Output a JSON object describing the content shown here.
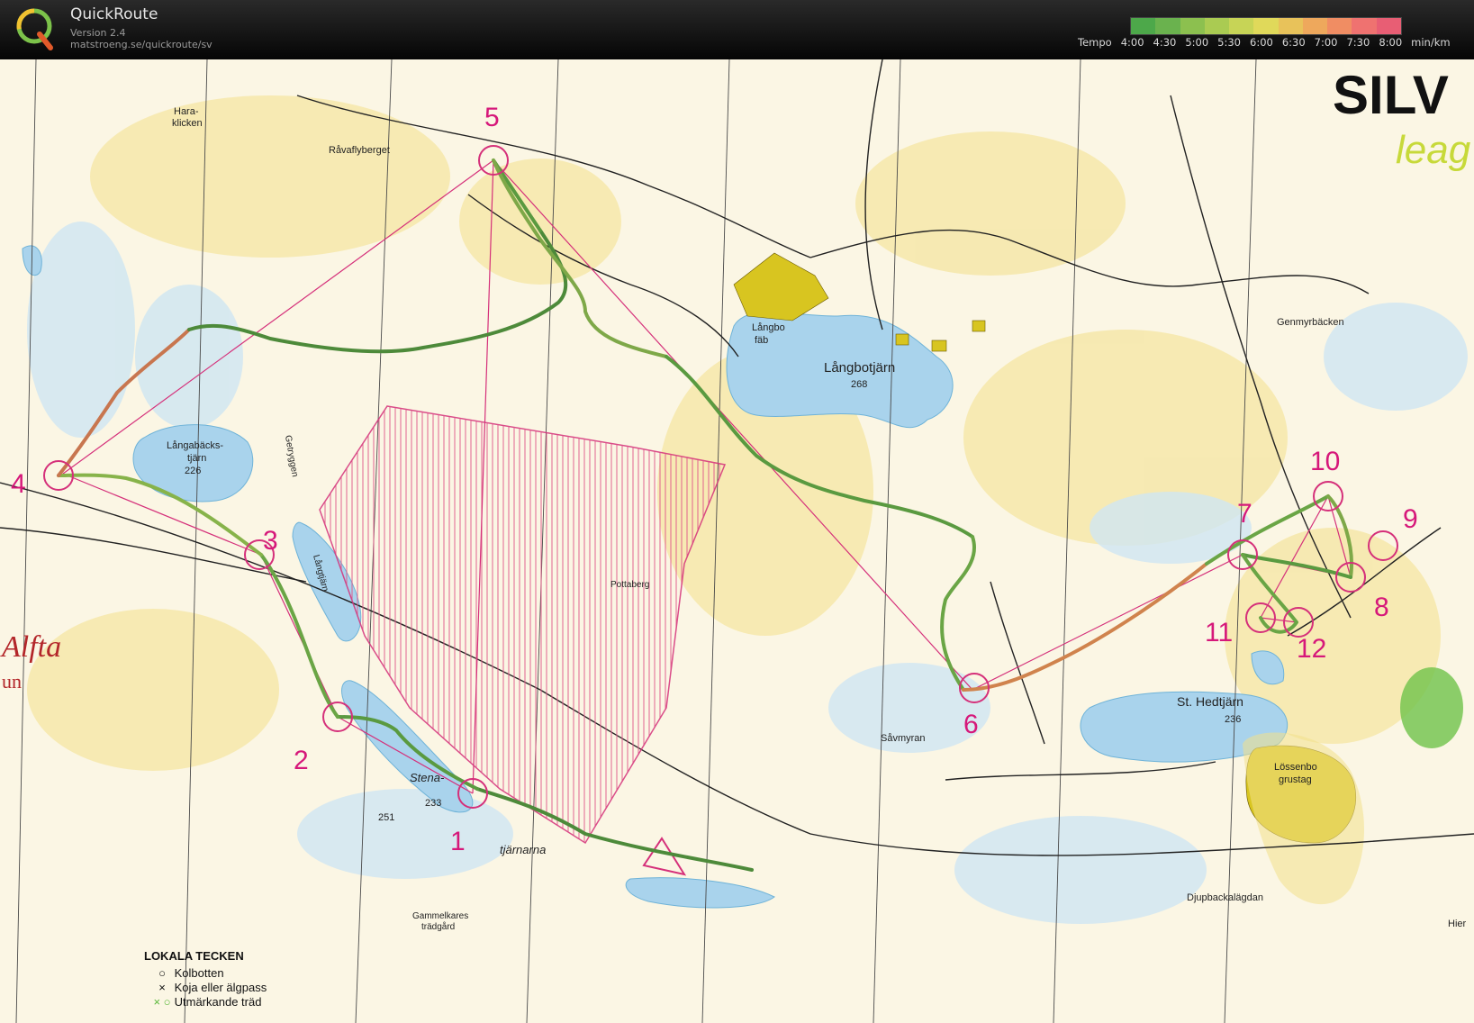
{
  "app": {
    "name": "QuickRoute",
    "version": "Version 2.4",
    "url": "matstroeng.se/quickroute/sv"
  },
  "pace_scale": {
    "label": "Tempo",
    "ticks": [
      "4:00",
      "4:30",
      "5:00",
      "5:30",
      "6:00",
      "6:30",
      "7:00",
      "7:30",
      "8:00"
    ],
    "unit": "min/km",
    "colors": [
      "#4da84a",
      "#6ab24e",
      "#8cc04f",
      "#aacb52",
      "#c7d456",
      "#e0d95a",
      "#e8c25a",
      "#eea85c",
      "#f08d63",
      "#ef7270",
      "#e85e74"
    ]
  },
  "map": {
    "place_names": {
      "hara": "Hara-",
      "klicken": "klicken",
      "ravaflyberget": "Råvaflyberget",
      "langbo": "Långbo",
      "fab": "fäb",
      "langbotjarn": "Långbotjärn",
      "langbotjarn_elev": "268",
      "langabacks": "Långabäcks-",
      "tjarn": "tjärn",
      "langabacks_elev": "226",
      "getryggen": "Getryggen",
      "langtjarn": "Långtjärn",
      "pottaberg": "Pottaberg",
      "stena": "Stena-",
      "stena_elev": "233",
      "elev_251": "251",
      "tjarnarna": "tjärnarna",
      "savmyran": "Såvmyran",
      "st_hedtjarn": "St. Hedtjärn",
      "st_hedtjarn_elev": "236",
      "lossenbo": "Lössenbo",
      "grustag": "grustag",
      "genmyrbacken": "Genmyrbäcken",
      "djupbackalagdan": "Djupbackalägdan",
      "gammelkares": "Gammelkares",
      "tradgard": "trädgård",
      "alfta": "Alfta",
      "un": "un",
      "hier": "Hier",
      "silva": "SILV",
      "leag": "leag"
    },
    "controls": [
      "1",
      "2",
      "3",
      "4",
      "5",
      "6",
      "7",
      "8",
      "9",
      "10",
      "11",
      "12"
    ],
    "legend": {
      "title": "LOKALA TECKEN",
      "items": [
        {
          "symbol": "○",
          "text": "Kolbotten"
        },
        {
          "symbol": "×",
          "text": "Koja eller älgpass"
        },
        {
          "symbol": "× ○",
          "text": "Utmärkande träd"
        }
      ]
    }
  }
}
